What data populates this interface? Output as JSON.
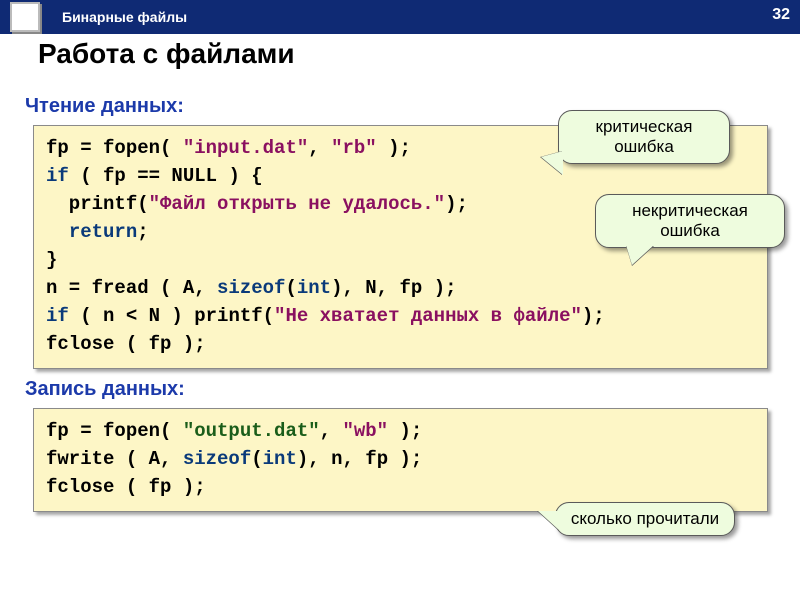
{
  "header": {
    "breadcrumb": "Бинарные файлы",
    "slide_number": "32"
  },
  "title": "Работа с файлами",
  "section1": {
    "label": "Чтение данных:"
  },
  "section2": {
    "label": "Запись данных:"
  },
  "code1": {
    "l1a": "fp = fopen( ",
    "l1b": "\"input.dat\"",
    "l1c": ", ",
    "l1d": "\"rb\"",
    "l1e": " );",
    "l2a": "if",
    "l2b": " ( fp == NULL ) {",
    "l3a": "  printf(",
    "l3b": "\"Файл открыть не удалось.\"",
    "l3c": ");",
    "l4a": "  ",
    "l4b": "return",
    "l4c": ";",
    "l5": "}",
    "l6a": "n = fread ( A, ",
    "l6b": "sizeof",
    "l6c": "(",
    "l6d": "int",
    "l6e": "), N, fp );",
    "l7a": "if",
    "l7b": " ( n < N ) printf(",
    "l7c": "\"Не хватает данных в файле\"",
    "l7d": ");",
    "l8": "fclose ( fp );"
  },
  "code2": {
    "l1a": "fp = fopen( ",
    "l1b": "\"output.dat\"",
    "l1c": ", ",
    "l1d": "\"wb\"",
    "l1e": " );",
    "l2a": "fwrite ( A, ",
    "l2b": "sizeof",
    "l2c": "(",
    "l2d": "int",
    "l2e": "), n, fp );",
    "l3": "fclose ( fp );"
  },
  "callouts": {
    "c1": "критическая ошибка",
    "c2": "некритическая ошибка",
    "c3": "сколько прочитали"
  }
}
